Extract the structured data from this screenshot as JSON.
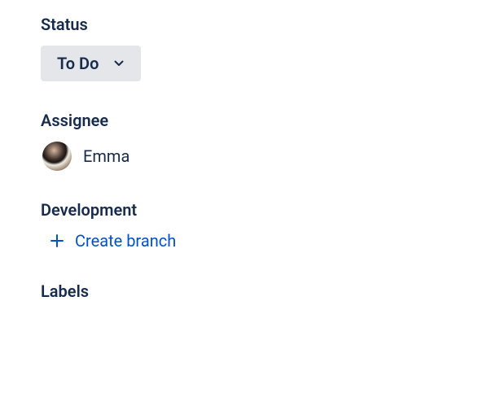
{
  "status": {
    "title": "Status",
    "value": "To Do"
  },
  "assignee": {
    "title": "Assignee",
    "name": "Emma"
  },
  "development": {
    "title": "Development",
    "create_branch_label": "Create branch"
  },
  "labels": {
    "title": "Labels"
  }
}
